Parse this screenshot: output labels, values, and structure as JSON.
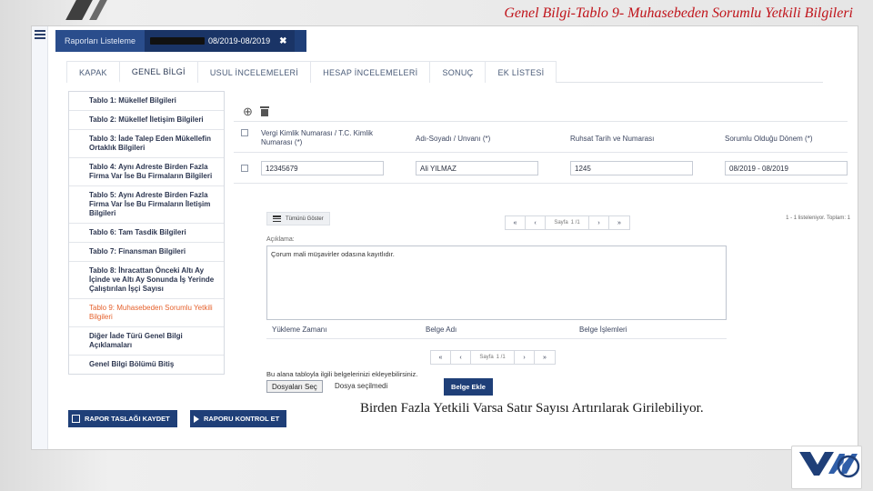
{
  "slide_title": "Genel Bilgi-Tablo 9- Muhasebeden Sorumlu Yetkili Bilgileri",
  "topbar": {
    "list_tab": "Raporları Listeleme",
    "active_tab_period": "08/2019-08/2019",
    "close_glyph": "✖"
  },
  "nav_tabs": [
    {
      "label": "KAPAK"
    },
    {
      "label": "GENEL BİLGİ"
    },
    {
      "label": "USUL İNCELEMELERİ"
    },
    {
      "label": "HESAP İNCELEMELERİ"
    },
    {
      "label": "SONUÇ"
    },
    {
      "label": "EK LİSTESİ"
    }
  ],
  "menu": [
    "Tablo 1: Mükellef Bilgileri",
    "Tablo 2: Mükellef İletişim Bilgileri",
    "Tablo 3: İade Talep Eden Mükellefin Ortaklık Bilgileri",
    "Tablo 4: Aynı Adreste Birden Fazla Firma Var İse Bu Firmaların Bilgileri",
    "Tablo 5: Aynı Adreste Birden Fazla Firma Var İse Bu Firmaların İletişim Bilgileri",
    "Tablo 6: Tam Tasdik Bilgileri",
    "Tablo 7: Finansman Bilgileri",
    "Tablo 8: İhracattan Önceki Altı Ay İçinde ve Altı Ay Sonunda İş Yerinde Çalıştırılan İşçi Sayısı",
    "Tablo 9: Muhasebeden Sorumlu Yetkili Bilgileri",
    "Diğer İade Türü Genel Bilgi Açıklamaları",
    "Genel Bilgi Bölümü Bitiş"
  ],
  "table": {
    "headers": [
      "Vergi Kimlik Numarası / T.C. Kimlik Numarası (*)",
      "Adı-Soyadı / Unvanı (*)",
      "Ruhsat Tarih ve Numarası",
      "Sorumlu Olduğu Dönem (*)"
    ],
    "row": [
      "12345679",
      "Ali YILMAZ",
      "1245",
      "08/2019 - 08/2019"
    ]
  },
  "show_all_label": "Tümünü Göster",
  "pager": {
    "first": "«",
    "prev": "‹",
    "page_label": "Sayfa",
    "page_value": "1 /1",
    "next": "›",
    "last": "»"
  },
  "record_info": "1 - 1 listeleniyor. Toplam: 1",
  "description": {
    "label": "Açıklama:",
    "value": "Çorum mali müşavirler odasına kayıtlıdır."
  },
  "documents": {
    "headers": [
      "Yükleme Zamanı",
      "Belge Adı",
      "Belge İşlemleri"
    ],
    "upload_note": "Bu alana tabloyla ilgili belgelerinizi ekleyebilirsiniz.",
    "file_button": "Dosyaları Seç",
    "file_status": "Dosya seçilmedi",
    "add_button": "Belge Ekle"
  },
  "buttons": {
    "save_draft": "RAPOR TASLAĞI KAYDET",
    "check_report": "RAPORU KONTROL ET"
  },
  "note": "Birden Fazla Yetkili Varsa Satır Sayısı Artırılarak Girilebiliyor.",
  "colors": {
    "title_red": "#c0141b",
    "brand_navy": "#1f3f78",
    "active_menu_orange": "#e5622e"
  }
}
